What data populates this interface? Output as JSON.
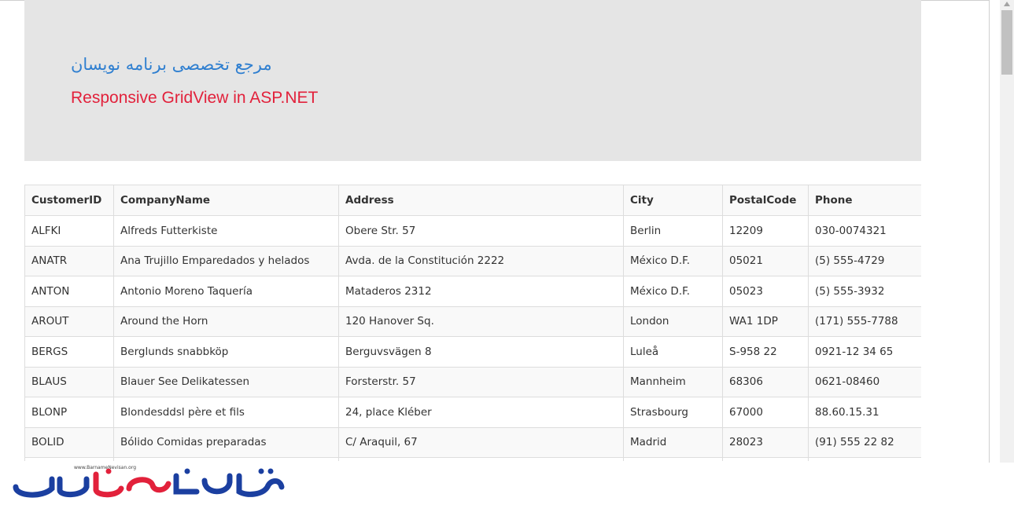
{
  "header": {
    "title": "مرجع تخصصی برنامه نویسان",
    "subtitle": "Responsive GridView in ASP.NET"
  },
  "grid": {
    "columns": [
      "CustomerID",
      "CompanyName",
      "Address",
      "City",
      "PostalCode",
      "Phone"
    ],
    "rows": [
      [
        "ALFKI",
        "Alfreds Futterkiste",
        "Obere Str. 57",
        "Berlin",
        "12209",
        "030-0074321"
      ],
      [
        "ANATR",
        "Ana Trujillo Emparedados y helados",
        "Avda. de la Constitución 2222",
        "México D.F.",
        "05021",
        "(5) 555-4729"
      ],
      [
        "ANTON",
        "Antonio Moreno Taquería",
        "Mataderos 2312",
        "México D.F.",
        "05023",
        "(5) 555-3932"
      ],
      [
        "AROUT",
        "Around the Horn",
        "120 Hanover Sq.",
        "London",
        "WA1 1DP",
        "(171) 555-7788"
      ],
      [
        "BERGS",
        "Berglunds snabbköp",
        "Berguvsvägen 8",
        "Luleå",
        "S-958 22",
        "0921-12 34 65"
      ],
      [
        "BLAUS",
        "Blauer See Delikatessen",
        "Forsterstr. 57",
        "Mannheim",
        "68306",
        "0621-08460"
      ],
      [
        "BLONP",
        "Blondesddsl père et fils",
        "24, place Kléber",
        "Strasbourg",
        "67000",
        "88.60.15.31"
      ],
      [
        "BOLID",
        "Bólido Comidas preparadas",
        "C/ Araquil, 67",
        "Madrid",
        "28023",
        "(91) 555 22 82"
      ],
      [
        "",
        "",
        "",
        "",
        "",
        ""
      ]
    ]
  },
  "watermark": {
    "logo_text": "برنامه نویسان",
    "url": "www.BarnameNevisan.org",
    "colors": {
      "primary": "#1b3fa0",
      "accent": "#e2213b"
    }
  },
  "colors": {
    "title": "#2f7fd0",
    "subtitle": "#e2213b",
    "jumbotron_bg": "#e5e5e5"
  }
}
